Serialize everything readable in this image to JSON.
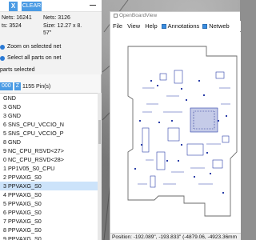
{
  "left_panel": {
    "toolbar": {
      "x_label": "X",
      "clear_label": "CLEAR"
    },
    "stats": {
      "nets_total": "Nets: 16241",
      "parts_count": "ts: 3524",
      "nets_shown": "Nets: 3126",
      "size_line1": "Size: 12.27 x 8.",
      "size_line2": "57\""
    },
    "options": {
      "zoom_selected": "Zoom on selected net",
      "select_all_parts": "Select all parts on net",
      "parts_selected": "parts selected"
    },
    "pin_bar": {
      "chip1": "000",
      "chip2": "Z",
      "pin_count": "1155 Pin(s)"
    },
    "net_list": [
      "GND",
      "3  GND",
      "3  GND",
      "6  SNS_CPU_VCCIO_N",
      "5  SNS_CPU_VCCIO_P",
      "8  GND",
      "9  NC_CPU_RSVD<27>",
      "0  NC_CPU_RSVD<28>",
      "1  PP1V05_S0_CPU",
      "2  PPVAXG_S0",
      "3  PPVAXG_S0",
      "4  PPVAXG_S0",
      "5  PPVAXG_S0",
      "6  PPVAXG_S0",
      "7  PPVAXG_S0",
      "8  PPVAXG_S0",
      "9  PPVAXG_S0"
    ],
    "selected_index": 10
  },
  "viewer": {
    "window_title": "OpenBoardView",
    "menu": {
      "file": "File",
      "view": "View",
      "help": "Help"
    },
    "toggles": {
      "annotations": "Annotations",
      "netweb": "Netweb"
    },
    "status": "Position: -192.089\", -193.833\" (-4879.06, -4923.36mm"
  },
  "colors": {
    "accent": "#4b9be4",
    "selection": "#cce3fa",
    "board_outline": "#6a6a6a",
    "parts": "#2b3ea8"
  }
}
